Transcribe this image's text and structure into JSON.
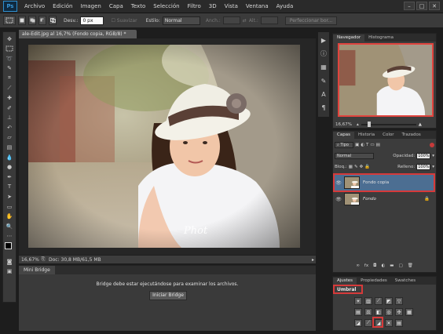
{
  "app": {
    "logo": "Ps"
  },
  "menu": [
    "Archivo",
    "Edición",
    "Imagen",
    "Capa",
    "Texto",
    "Selección",
    "Filtro",
    "3D",
    "Vista",
    "Ventana",
    "Ayuda"
  ],
  "window_controls": {
    "minimize": "–",
    "maximize": "□",
    "close": "✕"
  },
  "options": {
    "feather_label": "Desv.:",
    "feather_value": "0 px",
    "antialias_label": "Suavizar",
    "style_label": "Estilo:",
    "style_value": "Normal",
    "width_label": "Anch.:",
    "height_label": "Alt.:",
    "refine_button": "Perfeccionar bor..."
  },
  "document": {
    "tab_title": "ale-Edit.jpg al 16,7% (Fondo copia, RGB/8) *",
    "zoom": "16,67%",
    "doc_size": "Doc: 30,8 MB/61,5 MB",
    "watermark": "Phot"
  },
  "minibridge": {
    "tab": "Mini Bridge",
    "message": "Bridge debe estar ejecutándose para examinar los archivos.",
    "button": "Iniciar Bridge"
  },
  "navigator": {
    "tabs": [
      "Navegador",
      "Histograma"
    ],
    "zoom": "16,67%"
  },
  "layers": {
    "tabs": [
      "Capas",
      "Historia",
      "Color",
      "Trazados"
    ],
    "filter_type": "Tipo",
    "blend_mode": "Normal",
    "opacity_label": "Opacidad:",
    "opacity_value": "100%",
    "lock_label": "Bloq.:",
    "fill_label": "Relleno:",
    "fill_value": "100%",
    "items": [
      {
        "name": "Fondo copia",
        "selected": true
      },
      {
        "name": "Fondo",
        "locked": true
      }
    ]
  },
  "adjustments": {
    "tabs": [
      "Ajustes",
      "Propiedades",
      "Swatches"
    ],
    "tab_swatches": "Swatches",
    "hover_label": "Umbral"
  },
  "colors": {
    "accent": "#2d8ecf",
    "highlight": "#d63a3a",
    "selected_layer": "#4c6e92"
  }
}
